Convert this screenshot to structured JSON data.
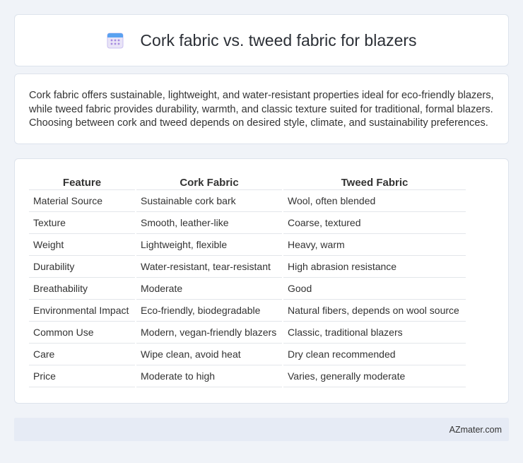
{
  "header": {
    "title": "Cork fabric vs. tweed fabric for blazers",
    "icon": "calendar-icon"
  },
  "summary": {
    "text": "Cork fabric offers sustainable, lightweight, and water-resistant properties ideal for eco-friendly blazers, while tweed fabric provides durability, warmth, and classic texture suited for traditional, formal blazers. Choosing between cork and tweed depends on desired style, climate, and sustainability preferences."
  },
  "table": {
    "headers": [
      "Feature",
      "Cork Fabric",
      "Tweed Fabric"
    ],
    "rows": [
      [
        "Material Source",
        "Sustainable cork bark",
        "Wool, often blended"
      ],
      [
        "Texture",
        "Smooth, leather-like",
        "Coarse, textured"
      ],
      [
        "Weight",
        "Lightweight, flexible",
        "Heavy, warm"
      ],
      [
        "Durability",
        "Water-resistant, tear-resistant",
        "High abrasion resistance"
      ],
      [
        "Breathability",
        "Moderate",
        "Good"
      ],
      [
        "Environmental Impact",
        "Eco-friendly, biodegradable",
        "Natural fibers, depends on wool source"
      ],
      [
        "Common Use",
        "Modern, vegan-friendly blazers",
        "Classic, traditional blazers"
      ],
      [
        "Care",
        "Wipe clean, avoid heat",
        "Dry clean recommended"
      ],
      [
        "Price",
        "Moderate to high",
        "Varies, generally moderate"
      ]
    ]
  },
  "footer": {
    "brand": "AZmater.com"
  },
  "colors": {
    "background": "#f0f3f8",
    "card": "#ffffff",
    "footer": "#e6ebf5",
    "text": "#333333"
  }
}
